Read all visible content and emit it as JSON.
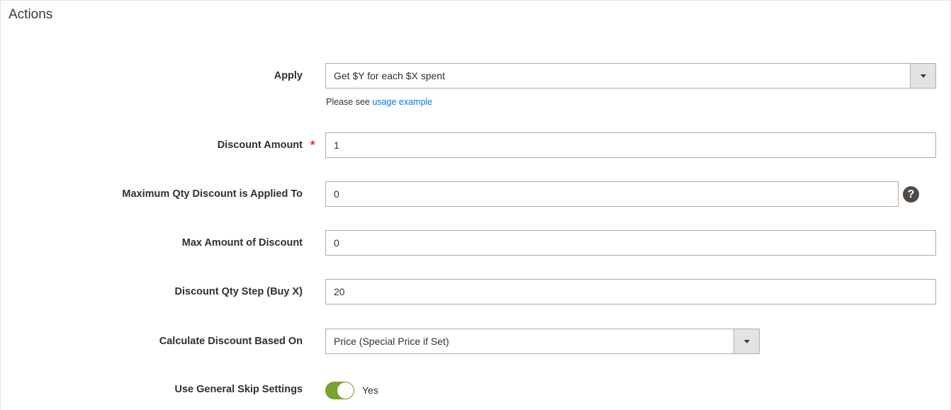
{
  "section": {
    "title": "Actions"
  },
  "apply": {
    "label": "Apply",
    "value": "Get $Y for each $X spent",
    "note_prefix": "Please see",
    "note_link": "usage example"
  },
  "discount_amount": {
    "label": "Discount Amount",
    "required_mark": "*",
    "value": "1"
  },
  "max_qty": {
    "label": "Maximum Qty Discount is Applied To",
    "value": "0",
    "help_glyph": "?"
  },
  "max_amount": {
    "label": "Max Amount of Discount",
    "value": "0"
  },
  "qty_step": {
    "label": "Discount Qty Step (Buy X)",
    "value": "20"
  },
  "calc_based_on": {
    "label": "Calculate Discount Based On",
    "value": "Price (Special Price if Set)"
  },
  "skip_settings": {
    "label": "Use General Skip Settings",
    "toggle_on": true,
    "toggle_text": "Yes"
  },
  "colors": {
    "accent_toggle": "#79a22e",
    "link": "#007bdb",
    "required": "#e22626",
    "help_icon": "#514943"
  }
}
